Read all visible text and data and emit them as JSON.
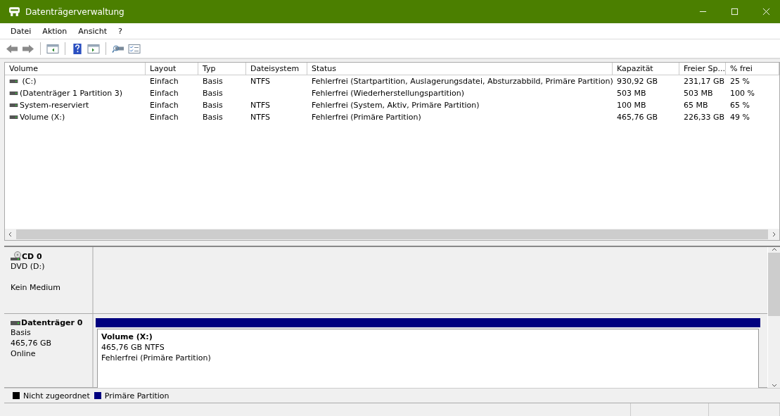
{
  "window": {
    "title": "Datenträgerverwaltung"
  },
  "menu": [
    "Datei",
    "Aktion",
    "Ansicht",
    "?"
  ],
  "table": {
    "columns": [
      "Volume",
      "Layout",
      "Typ",
      "Dateisystem",
      "Status",
      "Kapazität",
      "Freier Sp...",
      "% frei"
    ],
    "rows": [
      [
        " (C:)",
        "Einfach",
        "Basis",
        "NTFS",
        "Fehlerfrei (Startpartition, Auslagerungsdatei, Absturzabbild, Primäre Partition)",
        "930,92 GB",
        "231,17 GB",
        "25 %"
      ],
      [
        "(Datenträger 1 Partition 3)",
        "Einfach",
        "Basis",
        "",
        "Fehlerfrei (Wiederherstellungspartition)",
        "503 MB",
        "503 MB",
        "100 %"
      ],
      [
        "System-reserviert",
        "Einfach",
        "Basis",
        "NTFS",
        "Fehlerfrei (System, Aktiv, Primäre Partition)",
        "100 MB",
        "65 MB",
        "65 %"
      ],
      [
        "Volume (X:)",
        "Einfach",
        "Basis",
        "NTFS",
        "Fehlerfrei (Primäre Partition)",
        "465,76 GB",
        "226,33 GB",
        "49 %"
      ]
    ]
  },
  "disks": [
    {
      "kind": "cd",
      "name": "CD 0",
      "lines": [
        "DVD (D:)"
      ],
      "note": "Kein Medium"
    },
    {
      "kind": "disk",
      "name": "Datenträger 0",
      "lines": [
        "Basis",
        "465,76 GB",
        "Online"
      ],
      "partitions": [
        {
          "name": "Volume  (X:)",
          "size": "465,76 GB NTFS",
          "status": "Fehlerfrei (Primäre Partition)",
          "color": "#00007f"
        }
      ]
    }
  ],
  "legend": [
    {
      "label": "Nicht zugeordnet",
      "color": "#000000"
    },
    {
      "label": "Primäre Partition",
      "color": "#00007f"
    }
  ]
}
